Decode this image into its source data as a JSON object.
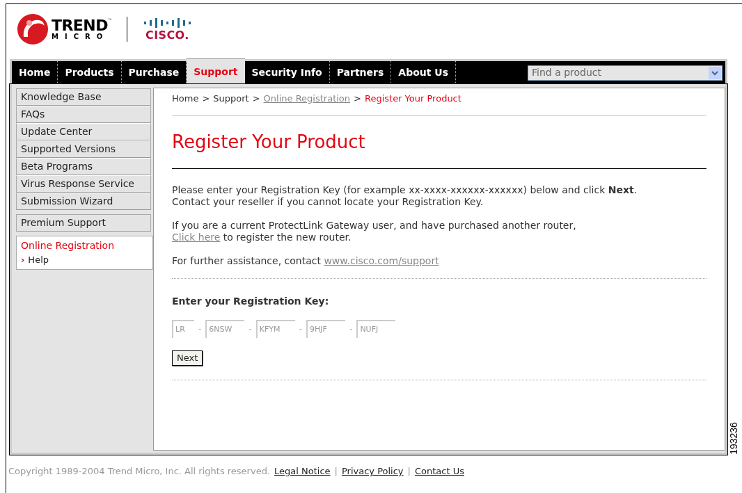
{
  "header": {
    "brand_1": {
      "word_1": "TREND",
      "word_2": "MICRO",
      "mark": "™"
    },
    "brand_2": "CISCO."
  },
  "nav": {
    "tabs": [
      {
        "label": "Home",
        "selected": false
      },
      {
        "label": "Products",
        "selected": false
      },
      {
        "label": "Purchase",
        "selected": false
      },
      {
        "label": "Support",
        "selected": true
      },
      {
        "label": "Security Info",
        "selected": false
      },
      {
        "label": "Partners",
        "selected": false
      },
      {
        "label": "About Us",
        "selected": false
      }
    ],
    "product_select": {
      "value": "Find a product"
    }
  },
  "sidebar": {
    "groups": [
      [
        {
          "label": "Knowledge Base",
          "selected": false
        },
        {
          "label": "FAQs",
          "selected": false
        },
        {
          "label": "Update Center",
          "selected": false
        },
        {
          "label": "Supported Versions",
          "selected": false
        },
        {
          "label": "Beta Programs",
          "selected": false
        },
        {
          "label": "Virus Response Service",
          "selected": false
        },
        {
          "label": "Submission Wizard",
          "selected": false
        }
      ],
      [
        {
          "label": "Premium Support",
          "selected": false
        }
      ]
    ],
    "current": {
      "label": "Online Registration",
      "sub_marker": "›",
      "sub_item": "Help"
    }
  },
  "breadcrumb": [
    {
      "label": "Home",
      "kind": "plain"
    },
    {
      "label": "Support",
      "kind": "plain"
    },
    {
      "label": "Online Registration",
      "kind": "link"
    },
    {
      "label": "Register Your Product",
      "kind": "current"
    }
  ],
  "breadcrumb_separator": ">",
  "title": "Register Your Product",
  "paragraphs": [
    {
      "lines": [
        "Please enter your Registration Key (for example xx-xxxx-xxxxxx-xxxxxx) below and click **Next**.",
        "Contact your reseller if you cannot locate your Registration Key."
      ]
    },
    {
      "line_1": "If you are a current ProtectLink Gateway user, and have purchased another router,",
      "link": "Click here",
      "after_link": " to register the new router."
    },
    {
      "before_link": "For further assistance, contact ",
      "link": "www.cisco.com/support"
    }
  ],
  "form": {
    "label": "Enter your Registration Key:",
    "separator": "-",
    "key_fields": [
      {
        "value": "LR"
      },
      {
        "value": "6NSW"
      },
      {
        "value": "KFYM"
      },
      {
        "value": "9HJF"
      },
      {
        "value": "NUFJ"
      }
    ],
    "submit": "Next"
  },
  "footer": {
    "copyright": "Copyright 1989-2004 Trend Micro, Inc. All rights reserved.",
    "links": [
      "Legal Notice",
      "Privacy Policy",
      "Contact Us"
    ],
    "separator": "|"
  },
  "figure_number": "193236"
}
